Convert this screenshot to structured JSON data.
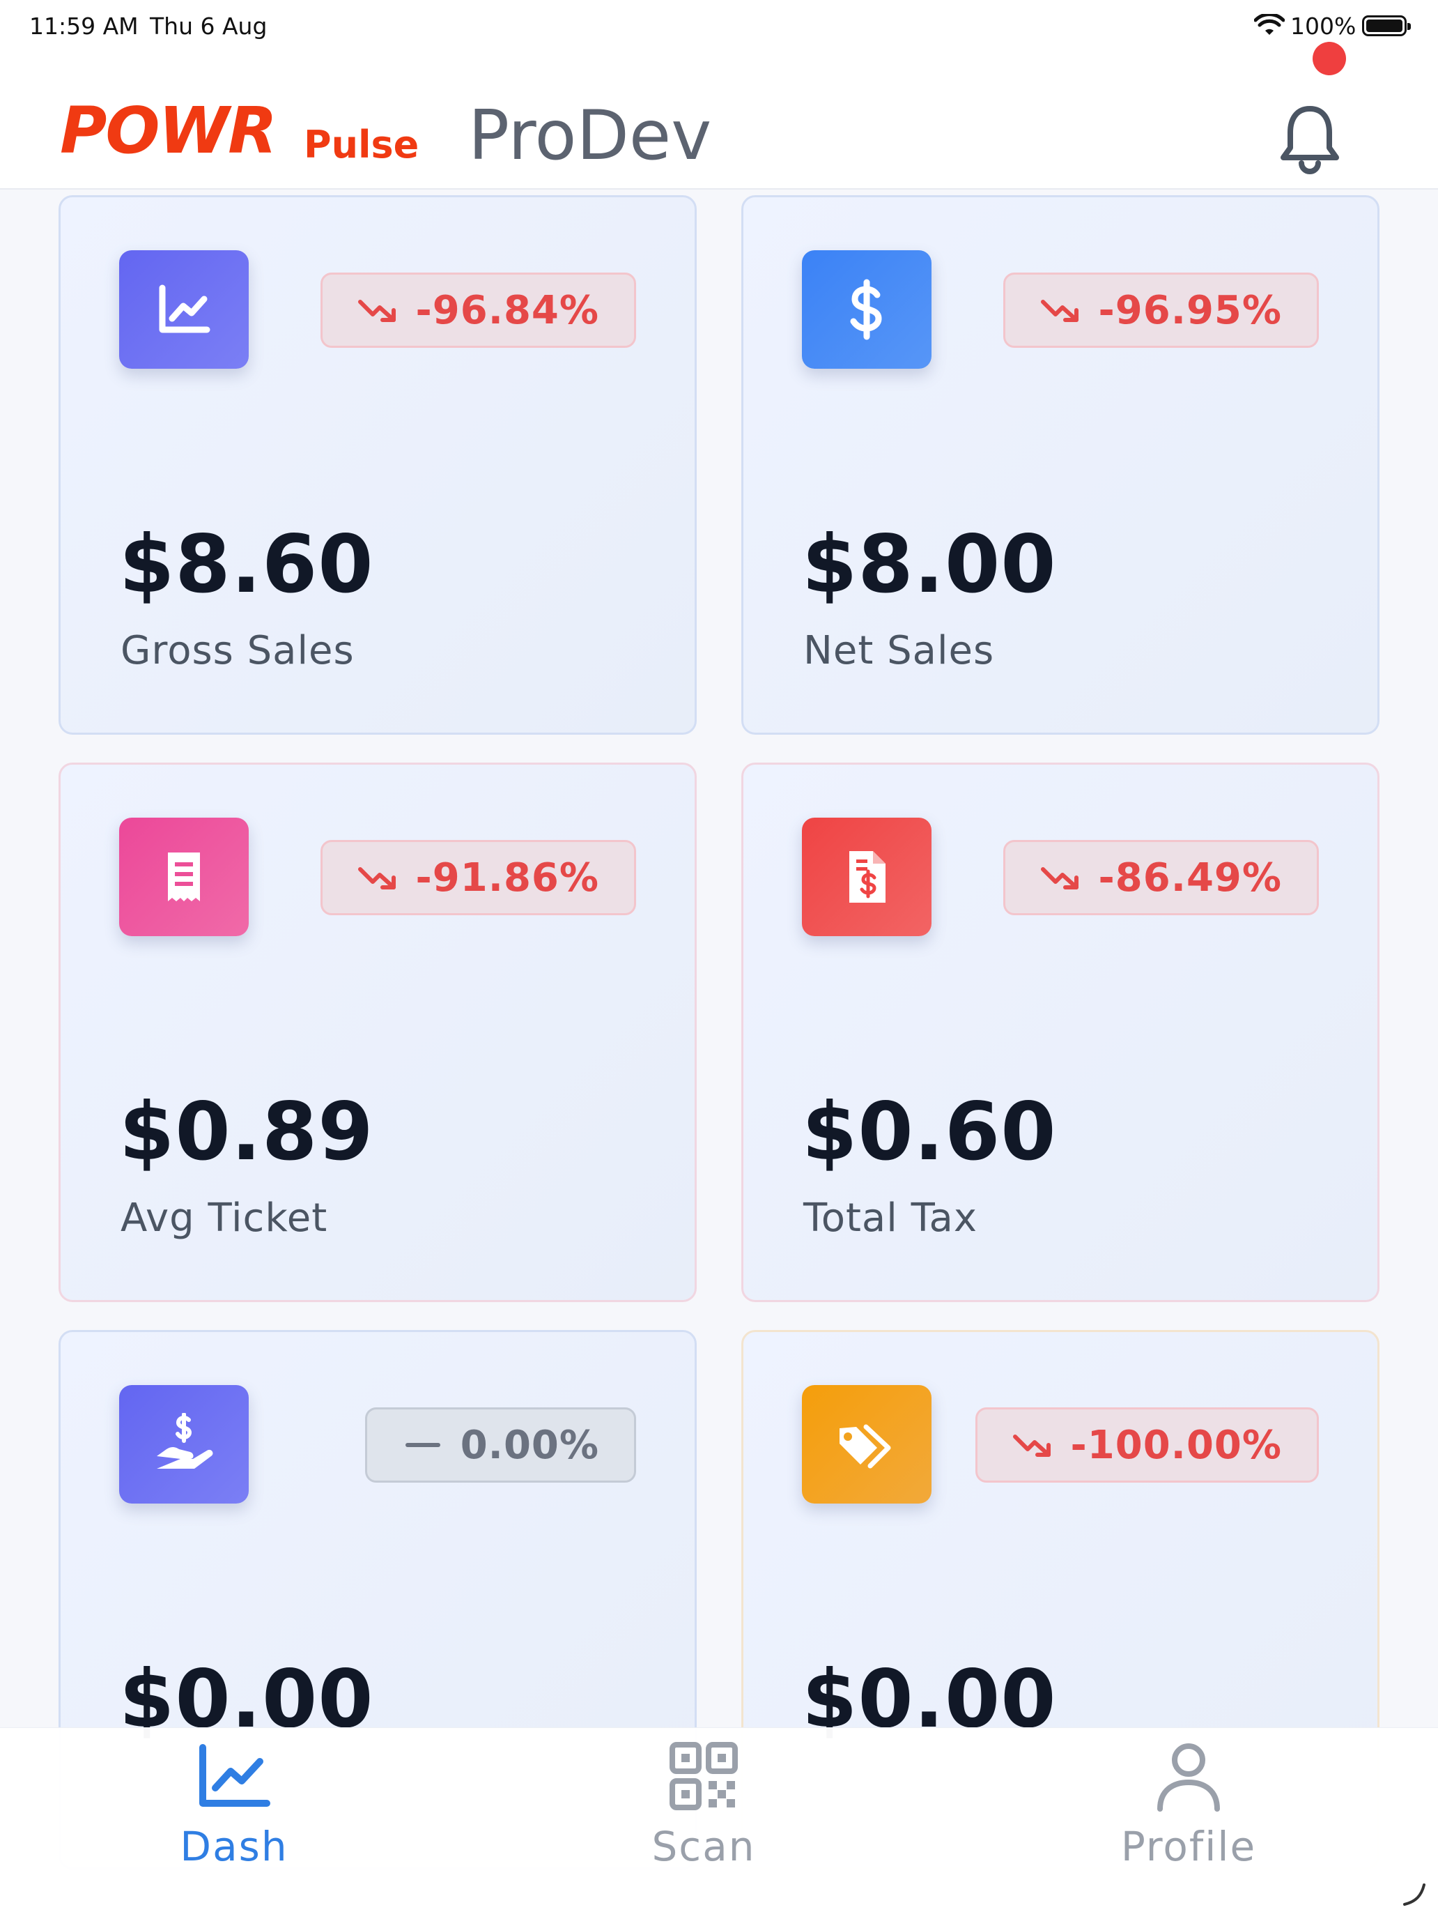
{
  "status_bar": {
    "time": "11:59 AM",
    "date": "Thu 6 Aug",
    "battery": "100%"
  },
  "header": {
    "logo_main": "POWR",
    "logo_sub": "Pulse",
    "store_name": "ProDev",
    "notification_icon": "bell-icon"
  },
  "cards": [
    {
      "icon": "chart-line-icon",
      "icon_color": "#6b6cf0",
      "change": "-96.84%",
      "trend": "down",
      "value": "$8.60",
      "label": "Gross Sales"
    },
    {
      "icon": "dollar-icon",
      "icon_color": "#3b82f6",
      "change": "-96.95%",
      "trend": "down",
      "value": "$8.00",
      "label": "Net Sales"
    },
    {
      "icon": "receipt-icon",
      "icon_color": "#ec4f98",
      "change": "-91.86%",
      "trend": "down",
      "value": "$0.89",
      "label": "Avg Ticket"
    },
    {
      "icon": "invoice-dollar-icon",
      "icon_color": "#ef4444",
      "change": "-86.49%",
      "trend": "down",
      "value": "$0.60",
      "label": "Total Tax"
    },
    {
      "icon": "hand-dollar-icon",
      "icon_color": "#6b6cf0",
      "change": "0.00%",
      "trend": "flat",
      "value": "$0.00",
      "label": ""
    },
    {
      "icon": "tags-icon",
      "icon_color": "#f2a21d",
      "change": "-100.00%",
      "trend": "down",
      "value": "$0.00",
      "label": ""
    }
  ],
  "tabs": [
    {
      "label": "Dash",
      "icon": "chart-line-icon",
      "active": true
    },
    {
      "label": "Scan",
      "icon": "qr-code-icon",
      "active": false
    },
    {
      "label": "Profile",
      "icon": "user-icon",
      "active": false
    }
  ],
  "colors": {
    "brand": "#f03a12",
    "accent": "#2f7ee3",
    "negative": "#e54848",
    "neutral": "#6b7280"
  }
}
